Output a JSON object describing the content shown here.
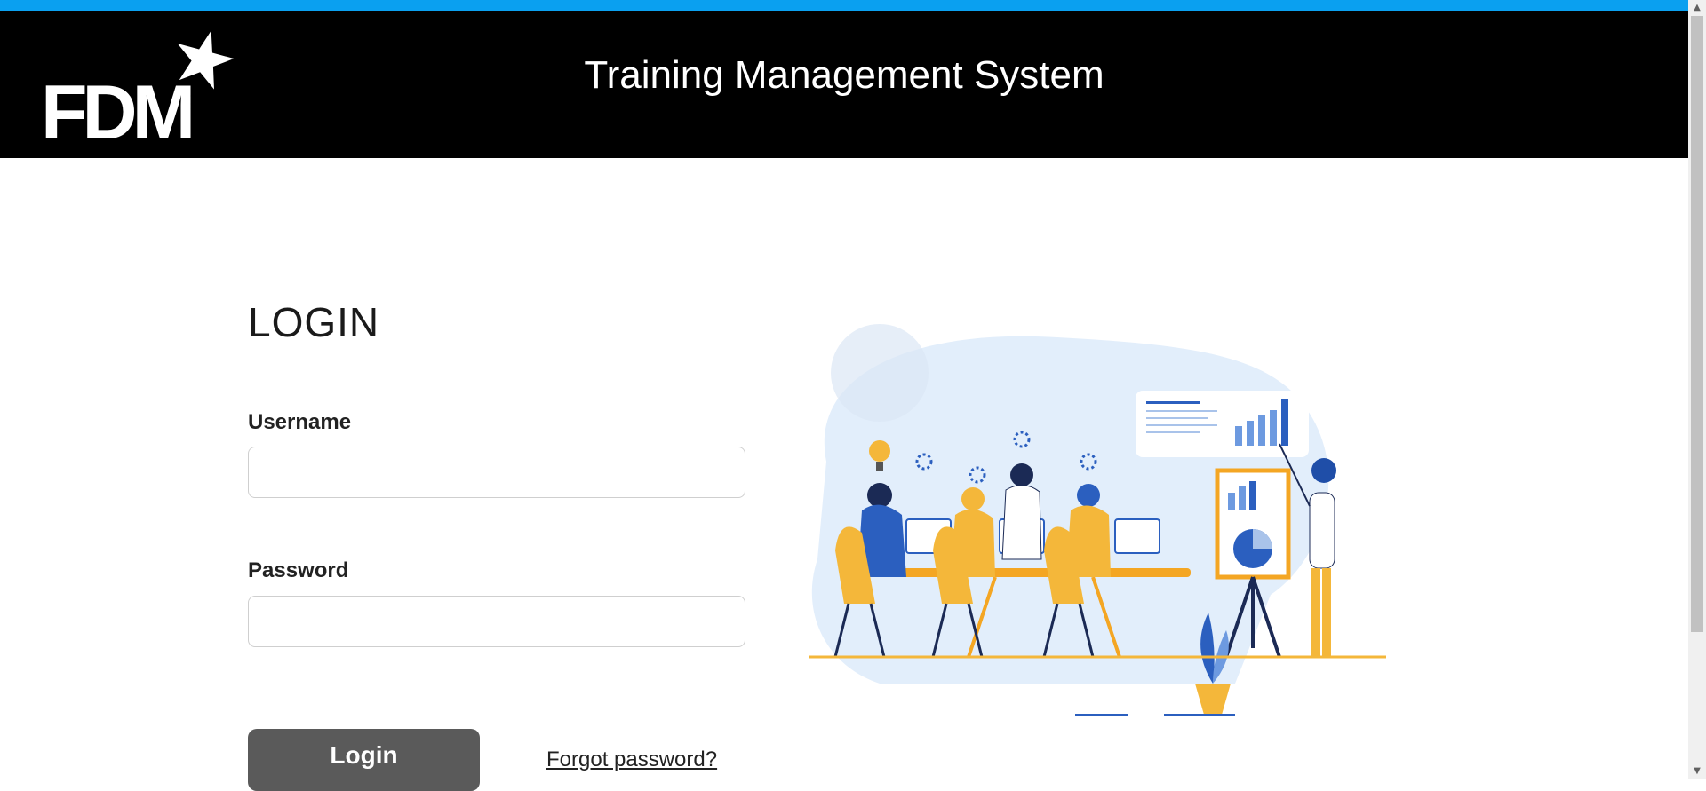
{
  "header": {
    "logo_text": "FDM",
    "title": "Training Management System",
    "background": "#000000",
    "accent_bar": "#0aa0f0"
  },
  "login": {
    "heading": "LOGIN",
    "username_label": "Username",
    "username_value": "",
    "password_label": "Password",
    "password_value": "",
    "submit_label": "Login",
    "forgot_link": "Forgot password?",
    "button_color": "#5a5a5a"
  },
  "illustration": {
    "icon": "team-meeting-illustration"
  },
  "scrollbar": {
    "up_icon": "arrow-up-icon",
    "down_icon": "arrow-down-icon"
  }
}
